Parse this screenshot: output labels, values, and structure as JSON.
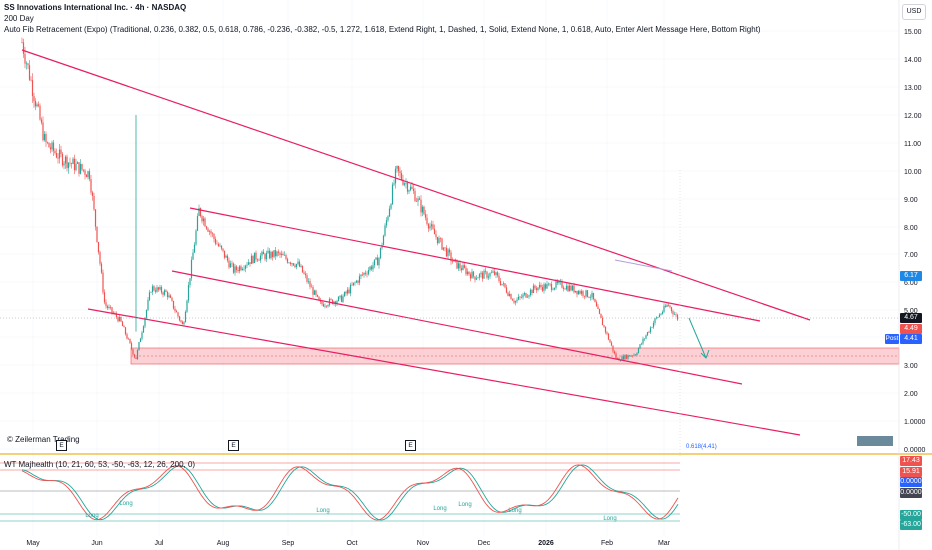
{
  "header": {
    "title": "SS Innovations International Inc. · 4h · NASDAQ",
    "sma_label": "200 Day",
    "fib_label": "Auto Fib Retracement (Expo) (Traditional, 0.236, 0.382, 0.5, 0.618, 0.786, -0.236, -0.382, -0.5, 1.272, 1.618, Extend Right, 1, Dashed, 1, Solid, Extend None, 1, 0.618, Auto, Enter Alert Message Here, Bottom Right)"
  },
  "currency": "USD",
  "watermark": "© Zeilerman Trading",
  "indicator_label": "WT Majhealth (10, 21, 60, 53, -50, -63, 12, 26, 200, 0)",
  "event_marker": "E",
  "fib_level_text": "0.618(4.41)",
  "colors": {
    "up": "#26a69a",
    "down": "#ef5350",
    "trend": "#e91e63",
    "zone_fill": "#f8b3bb",
    "wave_green": "#26a69a",
    "wave_red": "#ef5350"
  },
  "price_tags": {
    "p617": "6.17",
    "p467": "4.67",
    "p449": "4.49",
    "post_label": "Post",
    "p441": "4.41"
  },
  "osc_tags": {
    "o1743": "17.43",
    "o1591": "15.91",
    "o0a": "0.0000",
    "o0b": "0.0000",
    "om50": "-50.00",
    "om63": "-63.00"
  },
  "signals": {
    "long": "Long"
  },
  "chart_data": {
    "type": "candlestick",
    "title": "SS Innovations International Inc. · 4h · NASDAQ",
    "x_ticks": [
      "May",
      "Jun",
      "Jul",
      "Aug",
      "Sep",
      "Oct",
      "Nov",
      "Dec",
      "2026",
      "Feb",
      "Mar"
    ],
    "y_ticks": [
      "15.00",
      "14.00",
      "13.00",
      "12.00",
      "11.00",
      "10.00",
      "9.00",
      "8.00",
      "7.00",
      "6.00",
      "5.00",
      "4.00",
      "3.00",
      "2.00",
      "1.0000",
      "0.0000"
    ],
    "ylim": [
      0,
      15.4
    ],
    "log_scale": true,
    "price_path": [
      [
        "May",
        14.6
      ],
      [
        "May",
        11.0
      ],
      [
        "May",
        10.5
      ],
      [
        "May",
        10.2
      ],
      [
        "May",
        9.9
      ],
      [
        "Jun",
        5.2
      ],
      [
        "Jun",
        4.6
      ],
      [
        "Jun",
        3.2
      ],
      [
        "Jun",
        5.8
      ],
      [
        "Jul",
        5.6
      ],
      [
        "Jul",
        4.4
      ],
      [
        "Jul",
        8.6
      ],
      [
        "Jul",
        7.5
      ],
      [
        "Aug",
        6.4
      ],
      [
        "Aug",
        6.9
      ],
      [
        "Aug",
        7.0
      ],
      [
        "Sep",
        6.6
      ],
      [
        "Sep",
        5.2
      ],
      [
        "Sep",
        5.4
      ],
      [
        "Oct",
        6.2
      ],
      [
        "Oct",
        6.8
      ],
      [
        "Oct",
        10.0
      ],
      [
        "Oct",
        9.2
      ],
      [
        "Nov",
        7.8
      ],
      [
        "Nov",
        6.7
      ],
      [
        "Nov",
        6.2
      ],
      [
        "Dec",
        6.3
      ],
      [
        "Dec",
        5.3
      ],
      [
        "Dec",
        5.8
      ],
      [
        "2026",
        5.9
      ],
      [
        "2026",
        5.5
      ],
      [
        "Feb",
        3.2
      ],
      [
        "Feb",
        3.4
      ],
      [
        "Feb",
        4.6
      ],
      [
        "Mar",
        5.2
      ],
      [
        "Mar",
        4.67
      ]
    ],
    "support_zone": [
      3.0,
      3.6
    ],
    "last_price": 4.67,
    "levels": [
      6.17,
      4.67,
      4.49,
      4.41
    ],
    "oscillator": {
      "levels": [
        17.43,
        15.91,
        0,
        -50,
        -63
      ]
    }
  }
}
